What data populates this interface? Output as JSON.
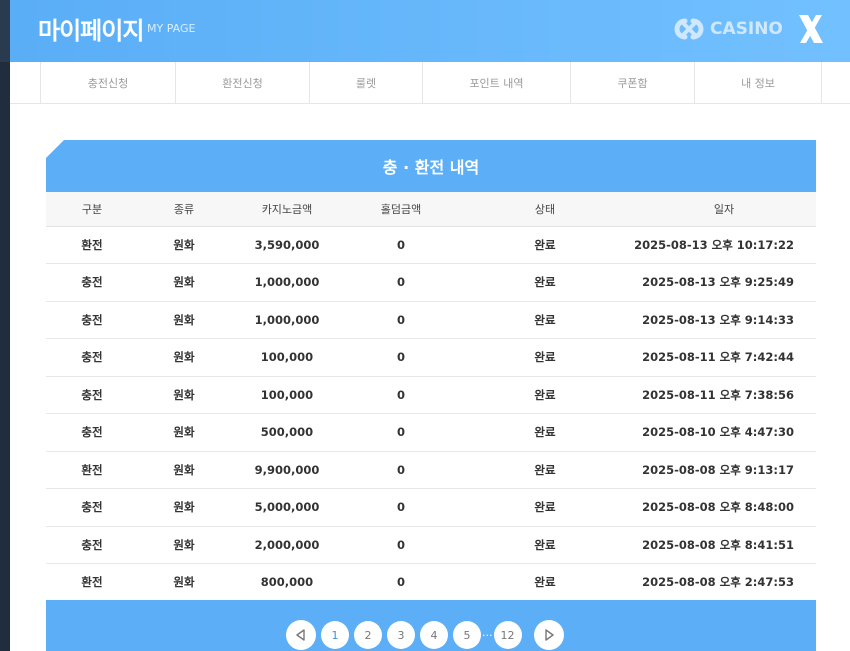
{
  "header": {
    "title": "마이페이지",
    "subtitle": "MY PAGE",
    "logo_text": "CASINO"
  },
  "nav": {
    "tabs": [
      "충전신청",
      "환전신청",
      "룰렛",
      "포인트 내역",
      "쿠폰함",
      "내 정보"
    ]
  },
  "panel": {
    "title": "충 · 환전 내역",
    "columns": [
      "구분",
      "종류",
      "카지노금액",
      "홀덤금액",
      "상태",
      "일자"
    ],
    "rows": [
      [
        "환전",
        "원화",
        "3,590,000",
        "0",
        "완료",
        "2025-08-13 오후 10:17:22"
      ],
      [
        "충전",
        "원화",
        "1,000,000",
        "0",
        "완료",
        "2025-08-13 오후 9:25:49"
      ],
      [
        "충전",
        "원화",
        "1,000,000",
        "0",
        "완료",
        "2025-08-13 오후 9:14:33"
      ],
      [
        "충전",
        "원화",
        "100,000",
        "0",
        "완료",
        "2025-08-11 오후 7:42:44"
      ],
      [
        "충전",
        "원화",
        "100,000",
        "0",
        "완료",
        "2025-08-11 오후 7:38:56"
      ],
      [
        "충전",
        "원화",
        "500,000",
        "0",
        "완료",
        "2025-08-10 오후 4:47:30"
      ],
      [
        "환전",
        "원화",
        "9,900,000",
        "0",
        "완료",
        "2025-08-08 오후 9:13:17"
      ],
      [
        "충전",
        "원화",
        "5,000,000",
        "0",
        "완료",
        "2025-08-08 오후 8:48:00"
      ],
      [
        "충전",
        "원화",
        "2,000,000",
        "0",
        "완료",
        "2025-08-08 오후 8:41:51"
      ],
      [
        "환전",
        "원화",
        "800,000",
        "0",
        "완료",
        "2025-08-08 오후 2:47:53"
      ]
    ]
  },
  "pagination": {
    "pages": [
      "1",
      "2",
      "3",
      "4",
      "5"
    ],
    "dots": "···",
    "last_page": "12",
    "current": "1"
  },
  "colors": {
    "accent": "#5caef6",
    "header_gradient_end": "#72c0ff"
  }
}
